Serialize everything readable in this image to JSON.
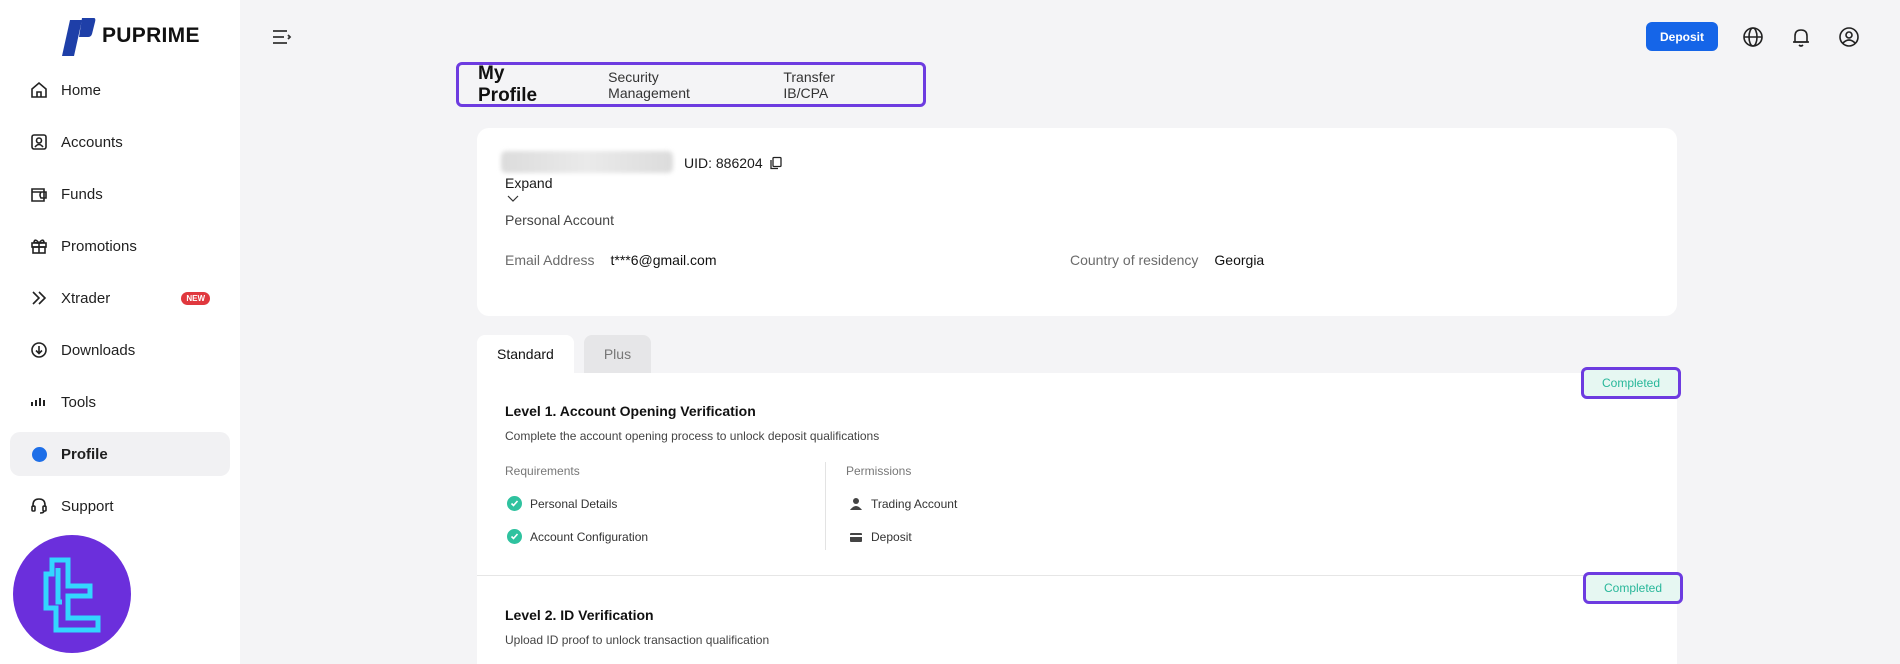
{
  "brand": {
    "name": "PUPRIME",
    "accent": "#1e3fa8"
  },
  "sidebar": {
    "items": [
      {
        "label": "Home",
        "icon": "home-icon"
      },
      {
        "label": "Accounts",
        "icon": "account-icon"
      },
      {
        "label": "Funds",
        "icon": "wallet-icon"
      },
      {
        "label": "Promotions",
        "icon": "gift-icon"
      },
      {
        "label": "Xtrader",
        "icon": "chevrons-icon",
        "badge": "NEW"
      },
      {
        "label": "Downloads",
        "icon": "download-icon"
      },
      {
        "label": "Tools",
        "icon": "signal-bars-icon"
      },
      {
        "label": "Profile",
        "icon": "dot-icon",
        "active": true
      },
      {
        "label": "Support",
        "icon": "headset-icon"
      }
    ]
  },
  "topbar": {
    "deposit_label": "Deposit",
    "deposit_color": "#1565e8",
    "icons": [
      "globe-icon",
      "bell-icon",
      "user-circle-icon"
    ]
  },
  "profile_tabs": {
    "items": [
      "My Profile",
      "Security Management",
      "Transfer IB/CPA"
    ],
    "active": "My Profile"
  },
  "profile_card": {
    "uid_label": "UID: 886204",
    "expand_label": "Expand",
    "account_type": "Personal Account",
    "email_label": "Email Address",
    "email_value": "t***6@gmail.com",
    "country_label": "Country of residency",
    "country_value": "Georgia"
  },
  "level_tabs": {
    "items": [
      "Standard",
      "Plus"
    ],
    "active": "Standard"
  },
  "levels": [
    {
      "title": "Level 1. Account Opening Verification",
      "description": "Complete the account opening process to unlock deposit qualifications",
      "status": "Completed",
      "requirements_label": "Requirements",
      "requirements": [
        "Personal Details",
        "Account Configuration"
      ],
      "permissions_label": "Permissions",
      "permissions": [
        "Trading Account",
        "Deposit"
      ]
    },
    {
      "title": "Level 2. ID Verification",
      "description": "Upload ID proof to unlock transaction qualification",
      "status": "Completed"
    }
  ],
  "colors": {
    "highlight": "#6d3be0",
    "status_text": "#28b79a",
    "check": "#2fc29f"
  }
}
